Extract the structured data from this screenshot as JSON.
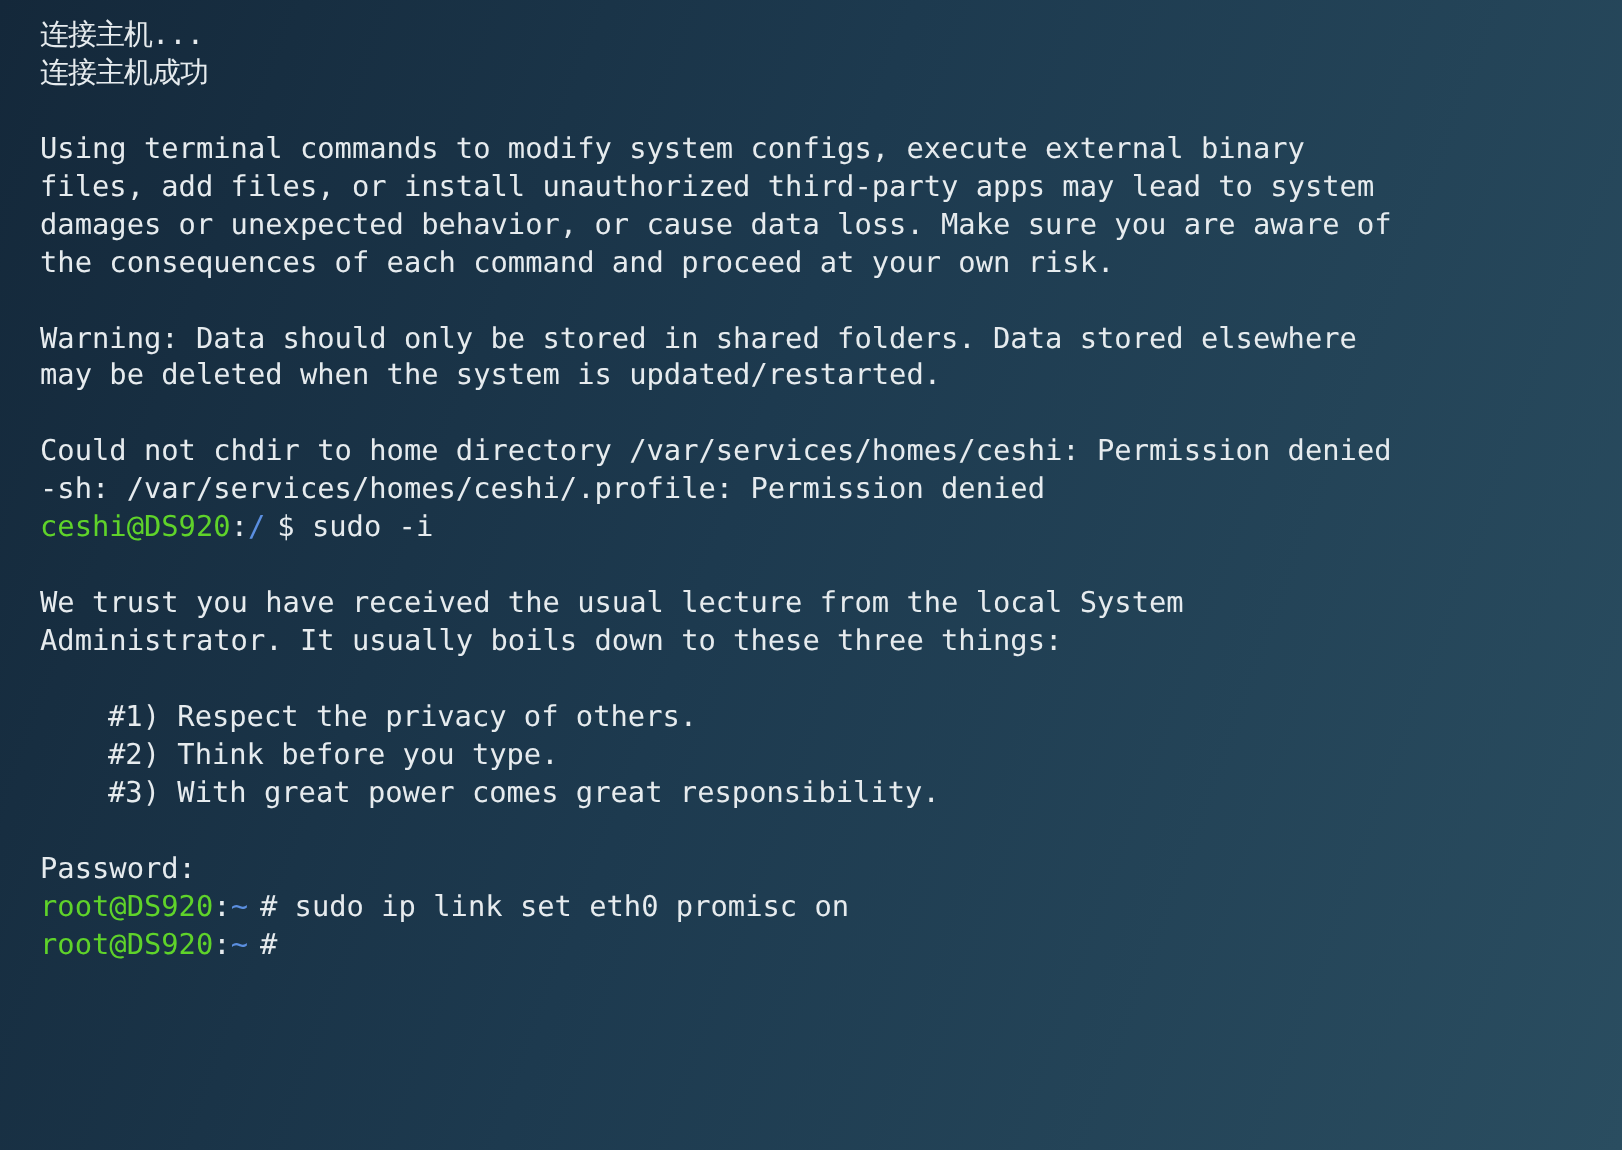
{
  "terminal": {
    "lines": [
      {
        "kind": "text",
        "text": "连接主机..."
      },
      {
        "kind": "text",
        "text": "连接主机成功"
      },
      {
        "kind": "blank"
      },
      {
        "kind": "text",
        "text": "Using terminal commands to modify system configs, execute external binary"
      },
      {
        "kind": "text",
        "text": "files, add files, or install unauthorized third-party apps may lead to system"
      },
      {
        "kind": "text",
        "text": "damages or unexpected behavior, or cause data loss. Make sure you are aware of"
      },
      {
        "kind": "text",
        "text": "the consequences of each command and proceed at your own risk."
      },
      {
        "kind": "blank"
      },
      {
        "kind": "text",
        "text": "Warning: Data should only be stored in shared folders. Data stored elsewhere"
      },
      {
        "kind": "text",
        "text": "may be deleted when the system is updated/restarted."
      },
      {
        "kind": "blank"
      },
      {
        "kind": "text",
        "text": "Could not chdir to home directory /var/services/homes/ceshi: Permission denied"
      },
      {
        "kind": "text",
        "text": "-sh: /var/services/homes/ceshi/.profile: Permission denied"
      },
      {
        "kind": "prompt",
        "user_host": "ceshi@DS920",
        "separator": ":",
        "path": "/",
        "symbol": "$",
        "command": "sudo -i"
      },
      {
        "kind": "blank"
      },
      {
        "kind": "text",
        "text": "We trust you have received the usual lecture from the local System"
      },
      {
        "kind": "text",
        "text": "Administrator. It usually boils down to these three things:"
      },
      {
        "kind": "blank"
      },
      {
        "kind": "indented",
        "text": "#1) Respect the privacy of others."
      },
      {
        "kind": "indented",
        "text": "#2) Think before you type."
      },
      {
        "kind": "indented",
        "text": "#3) With great power comes great responsibility."
      },
      {
        "kind": "blank"
      },
      {
        "kind": "text",
        "text": "Password:"
      },
      {
        "kind": "prompt",
        "user_host": "root@DS920",
        "separator": ":",
        "path": "~",
        "symbol": "#",
        "command": "sudo ip link set eth0 promisc on"
      },
      {
        "kind": "prompt",
        "user_host": "root@DS920",
        "separator": ":",
        "path": "~",
        "symbol": "#"
      }
    ]
  }
}
